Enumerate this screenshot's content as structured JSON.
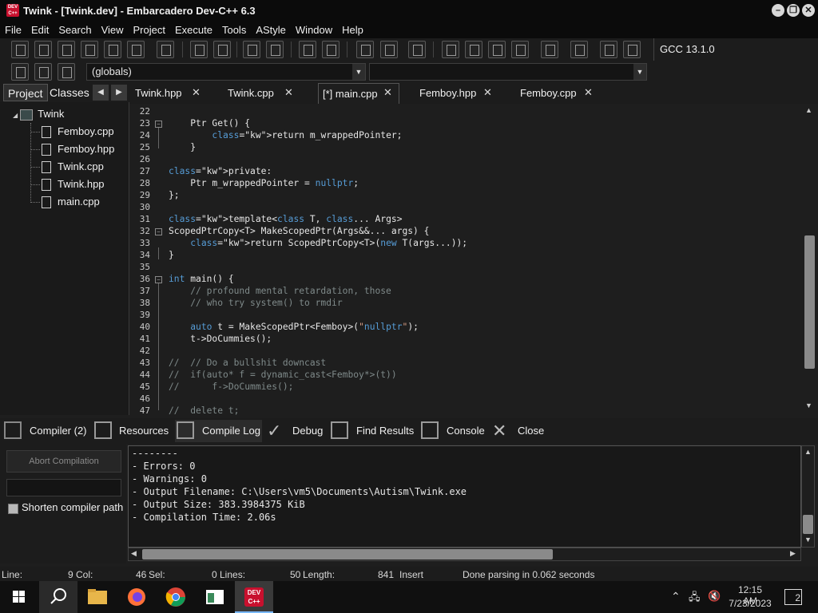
{
  "window": {
    "title": "Twink - [Twink.dev] - Embarcadero Dev-C++ 6.3",
    "app_icon_text": "DEV C++",
    "controls": {
      "minimize": "–",
      "restore": "❐",
      "close": "✕"
    }
  },
  "menu": [
    "File",
    "Edit",
    "Search",
    "View",
    "Project",
    "Execute",
    "Tools",
    "AStyle",
    "Window",
    "Help"
  ],
  "toolbar": {
    "compiler": "GCC 13.1.0",
    "scope_combo": "(globals)"
  },
  "left_panel": {
    "tabs": [
      "Project",
      "Classes"
    ],
    "project_name": "Twink",
    "files": [
      "Femboy.cpp",
      "Femboy.hpp",
      "Twink.cpp",
      "Twink.hpp",
      "main.cpp"
    ]
  },
  "editor_tabs": [
    {
      "label": "Twink.hpp",
      "active": false
    },
    {
      "label": "Twink.cpp",
      "active": false
    },
    {
      "label": "[*] main.cpp",
      "active": true
    },
    {
      "label": "Femboy.hpp",
      "active": false
    },
    {
      "label": "Femboy.cpp",
      "active": false
    }
  ],
  "code_lines": [
    {
      "n": "22",
      "text": ""
    },
    {
      "n": "23",
      "text": "    Ptr Get() {"
    },
    {
      "n": "24",
      "text": "        return m_wrappedPointer;"
    },
    {
      "n": "25",
      "text": "    }"
    },
    {
      "n": "26",
      "text": ""
    },
    {
      "n": "27",
      "text": "private:"
    },
    {
      "n": "28",
      "text": "    Ptr m_wrappedPointer = nullptr;"
    },
    {
      "n": "29",
      "text": "};"
    },
    {
      "n": "30",
      "text": ""
    },
    {
      "n": "31",
      "text": "template<class T, class... Args>"
    },
    {
      "n": "32",
      "text": "ScopedPtrCopy<T> MakeScopedPtr(Args&&... args) {"
    },
    {
      "n": "33",
      "text": "    return ScopedPtrCopy<T>(new T(args...));"
    },
    {
      "n": "34",
      "text": "}"
    },
    {
      "n": "35",
      "text": ""
    },
    {
      "n": "36",
      "text": "int main() {"
    },
    {
      "n": "37",
      "text": "    // profound mental retardation, those"
    },
    {
      "n": "38",
      "text": "    // who try system() to rmdir"
    },
    {
      "n": "39",
      "text": ""
    },
    {
      "n": "40",
      "text": "    auto t = MakeScopedPtr<Femboy>(\"nullptr\");"
    },
    {
      "n": "41",
      "text": "    t->DoCummies();"
    },
    {
      "n": "42",
      "text": ""
    },
    {
      "n": "43",
      "text": "//  // Do a bullshit downcast"
    },
    {
      "n": "44",
      "text": "//  if(auto* f = dynamic_cast<Femboy*>(t))"
    },
    {
      "n": "45",
      "text": "//      f->DoCummies();"
    },
    {
      "n": "46",
      "text": ""
    },
    {
      "n": "47",
      "text": "//  delete t;"
    }
  ],
  "bottom_tabs": [
    "Compiler (2)",
    "Resources",
    "Compile Log",
    "Debug",
    "Find Results",
    "Console",
    "Close"
  ],
  "compile_panel": {
    "abort_label": "Abort Compilation",
    "shorten_label": "Shorten compiler path",
    "log": [
      "--------",
      "- Errors: 0",
      "- Warnings: 0",
      "- Output Filename: C:\\Users\\vm5\\Documents\\Autism\\Twink.exe",
      "- Output Size: 383.3984375 KiB",
      "- Compilation Time: 2.06s"
    ]
  },
  "status": {
    "line_label": "Line:",
    "line_val": "9",
    "col_label": "Col:",
    "col_val": "46",
    "sel_label": "Sel:",
    "sel_val": "0",
    "lines_label": "Lines:",
    "lines_val": "50",
    "length_label": "Length:",
    "length_val": "841",
    "mode": "Insert",
    "message": "Done parsing in 0.062 seconds"
  },
  "taskbar": {
    "time": "12:15 AM",
    "date": "7/23/2023",
    "notifications": "2",
    "devcpp_label": "DEV C++"
  },
  "colors": {
    "keyword": "#569cd6",
    "comment": "#7f8a8a",
    "background": "#1e1e1e"
  }
}
